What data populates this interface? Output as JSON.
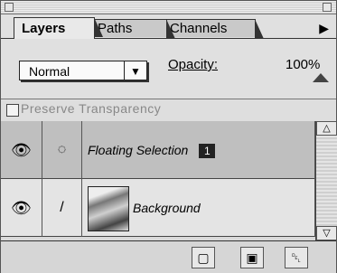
{
  "tabs": [
    "Layers",
    "Paths",
    "Channels"
  ],
  "tab_menu_icon": "▶",
  "blend_mode": "Normal",
  "opacity_label": "Opacity:",
  "opacity_value": "100%",
  "preserve_label": "Preserve Transparency",
  "layers": [
    {
      "name": "Floating Selection",
      "badge": "1",
      "visible_icon": "👁",
      "indicator": "◌"
    },
    {
      "name": "Background",
      "visible_icon": "👁",
      "indicator": "/"
    }
  ],
  "scroll_up": "△",
  "scroll_down": "▽",
  "bottom_buttons": [
    "▢",
    "▣",
    "␡"
  ]
}
